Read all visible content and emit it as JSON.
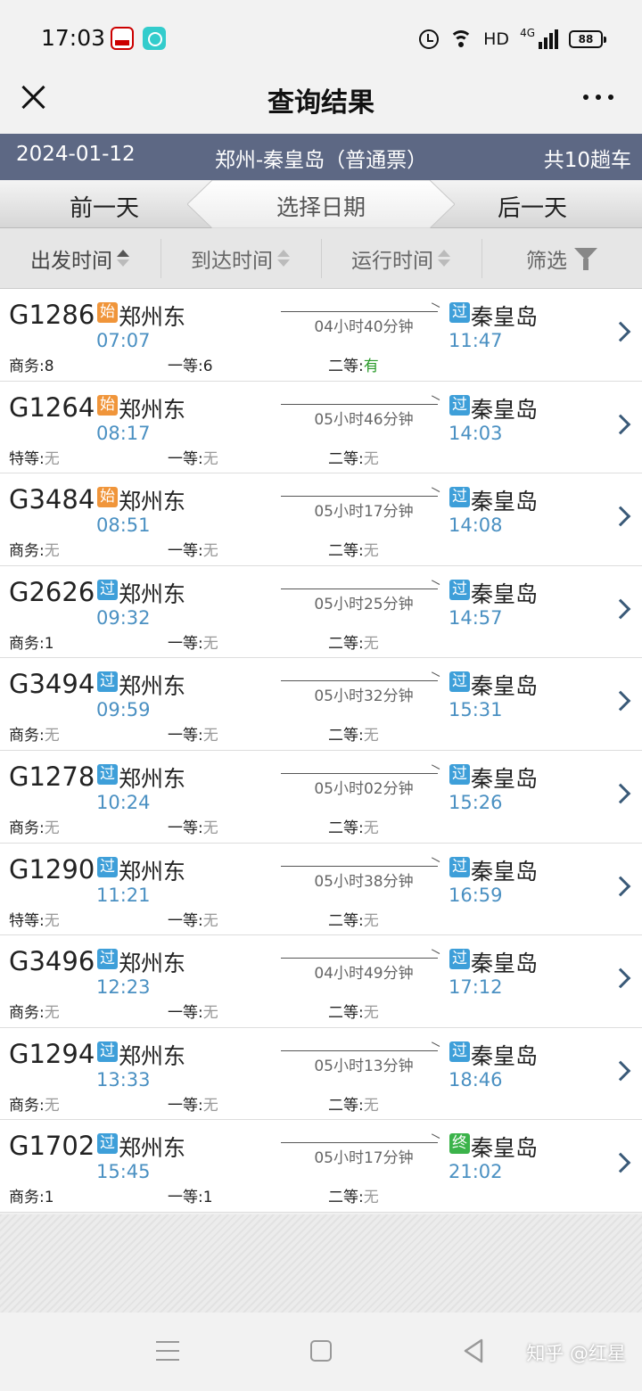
{
  "status_bar": {
    "time": "17:03",
    "network": "HD",
    "network_type": "4G",
    "battery": "88",
    "icons": [
      "railway-app-icon",
      "chat-app-icon",
      "alarm-icon",
      "wifi-icon",
      "signal-icon",
      "battery-icon"
    ]
  },
  "header": {
    "title": "查询结果"
  },
  "info_bar": {
    "date": "2024-01-12",
    "route": "郑州-秦皇岛（普通票）",
    "count": "共10趟车"
  },
  "date_nav": {
    "prev": "前一天",
    "select": "选择日期",
    "next": "后一天"
  },
  "sort_bar": {
    "departure": "出发时间",
    "arrival": "到达时间",
    "duration": "运行时间",
    "filter": "筛选"
  },
  "colors": {
    "info_bar_bg": "#5d6884",
    "time_blue": "#4a90c2",
    "badge_start": "#f0953a",
    "badge_pass": "#3e9fd9",
    "badge_end": "#3bb34a",
    "seat_available": "#2a9a2a",
    "seat_none": "#999999"
  },
  "trains": [
    {
      "no": "G1286",
      "from_badge": "始",
      "from_type": "start",
      "from": "郑州东",
      "dep": "07:07",
      "duration": "04小时40分钟",
      "to_badge": "过",
      "to_type": "pass",
      "to": "秦皇岛",
      "arr": "11:47",
      "seats": [
        {
          "label": "商务:",
          "value": "8",
          "state": "num"
        },
        {
          "label": "一等:",
          "value": "6",
          "state": "num"
        },
        {
          "label": "二等:",
          "value": "有",
          "state": "have"
        }
      ]
    },
    {
      "no": "G1264",
      "from_badge": "始",
      "from_type": "start",
      "from": "郑州东",
      "dep": "08:17",
      "duration": "05小时46分钟",
      "to_badge": "过",
      "to_type": "pass",
      "to": "秦皇岛",
      "arr": "14:03",
      "seats": [
        {
          "label": "特等:",
          "value": "无",
          "state": "none"
        },
        {
          "label": "一等:",
          "value": "无",
          "state": "none"
        },
        {
          "label": "二等:",
          "value": "无",
          "state": "none"
        }
      ]
    },
    {
      "no": "G3484",
      "from_badge": "始",
      "from_type": "start",
      "from": "郑州东",
      "dep": "08:51",
      "duration": "05小时17分钟",
      "to_badge": "过",
      "to_type": "pass",
      "to": "秦皇岛",
      "arr": "14:08",
      "seats": [
        {
          "label": "商务:",
          "value": "无",
          "state": "none"
        },
        {
          "label": "一等:",
          "value": "无",
          "state": "none"
        },
        {
          "label": "二等:",
          "value": "无",
          "state": "none"
        }
      ]
    },
    {
      "no": "G2626",
      "from_badge": "过",
      "from_type": "pass",
      "from": "郑州东",
      "dep": "09:32",
      "duration": "05小时25分钟",
      "to_badge": "过",
      "to_type": "pass",
      "to": "秦皇岛",
      "arr": "14:57",
      "seats": [
        {
          "label": "商务:",
          "value": "1",
          "state": "num"
        },
        {
          "label": "一等:",
          "value": "无",
          "state": "none"
        },
        {
          "label": "二等:",
          "value": "无",
          "state": "none"
        }
      ]
    },
    {
      "no": "G3494",
      "from_badge": "过",
      "from_type": "pass",
      "from": "郑州东",
      "dep": "09:59",
      "duration": "05小时32分钟",
      "to_badge": "过",
      "to_type": "pass",
      "to": "秦皇岛",
      "arr": "15:31",
      "seats": [
        {
          "label": "商务:",
          "value": "无",
          "state": "none"
        },
        {
          "label": "一等:",
          "value": "无",
          "state": "none"
        },
        {
          "label": "二等:",
          "value": "无",
          "state": "none"
        }
      ]
    },
    {
      "no": "G1278",
      "from_badge": "过",
      "from_type": "pass",
      "from": "郑州东",
      "dep": "10:24",
      "duration": "05小时02分钟",
      "to_badge": "过",
      "to_type": "pass",
      "to": "秦皇岛",
      "arr": "15:26",
      "seats": [
        {
          "label": "商务:",
          "value": "无",
          "state": "none"
        },
        {
          "label": "一等:",
          "value": "无",
          "state": "none"
        },
        {
          "label": "二等:",
          "value": "无",
          "state": "none"
        }
      ]
    },
    {
      "no": "G1290",
      "from_badge": "过",
      "from_type": "pass",
      "from": "郑州东",
      "dep": "11:21",
      "duration": "05小时38分钟",
      "to_badge": "过",
      "to_type": "pass",
      "to": "秦皇岛",
      "arr": "16:59",
      "seats": [
        {
          "label": "特等:",
          "value": "无",
          "state": "none"
        },
        {
          "label": "一等:",
          "value": "无",
          "state": "none"
        },
        {
          "label": "二等:",
          "value": "无",
          "state": "none"
        }
      ]
    },
    {
      "no": "G3496",
      "from_badge": "过",
      "from_type": "pass",
      "from": "郑州东",
      "dep": "12:23",
      "duration": "04小时49分钟",
      "to_badge": "过",
      "to_type": "pass",
      "to": "秦皇岛",
      "arr": "17:12",
      "seats": [
        {
          "label": "商务:",
          "value": "无",
          "state": "none"
        },
        {
          "label": "一等:",
          "value": "无",
          "state": "none"
        },
        {
          "label": "二等:",
          "value": "无",
          "state": "none"
        }
      ]
    },
    {
      "no": "G1294",
      "from_badge": "过",
      "from_type": "pass",
      "from": "郑州东",
      "dep": "13:33",
      "duration": "05小时13分钟",
      "to_badge": "过",
      "to_type": "pass",
      "to": "秦皇岛",
      "arr": "18:46",
      "seats": [
        {
          "label": "商务:",
          "value": "无",
          "state": "none"
        },
        {
          "label": "一等:",
          "value": "无",
          "state": "none"
        },
        {
          "label": "二等:",
          "value": "无",
          "state": "none"
        }
      ]
    },
    {
      "no": "G1702",
      "from_badge": "过",
      "from_type": "pass",
      "from": "郑州东",
      "dep": "15:45",
      "duration": "05小时17分钟",
      "to_badge": "终",
      "to_type": "end",
      "to": "秦皇岛",
      "arr": "21:02",
      "seats": [
        {
          "label": "商务:",
          "value": "1",
          "state": "num"
        },
        {
          "label": "一等:",
          "value": "1",
          "state": "num"
        },
        {
          "label": "二等:",
          "value": "无",
          "state": "none"
        }
      ]
    }
  ],
  "nav_bar": {
    "watermark": "知乎 @红星"
  }
}
